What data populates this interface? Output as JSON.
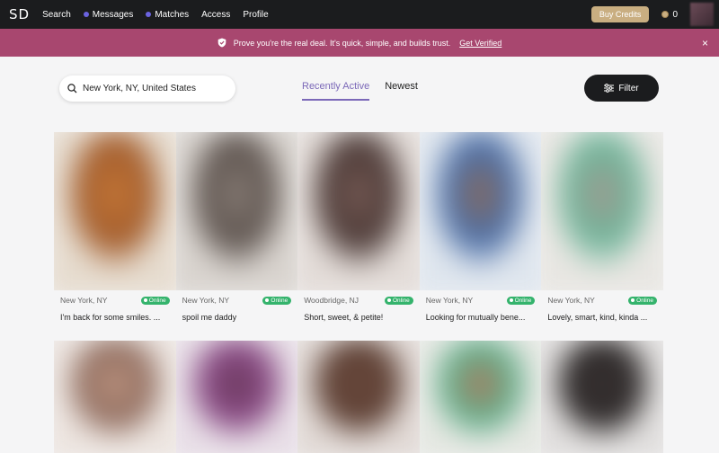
{
  "nav": {
    "logo": "SD",
    "items": [
      {
        "label": "Search",
        "dot": null
      },
      {
        "label": "Messages",
        "dot": "#6b63e0"
      },
      {
        "label": "Matches",
        "dot": "#6b63e0"
      },
      {
        "label": "Access",
        "dot": null
      },
      {
        "label": "Profile",
        "dot": null
      }
    ],
    "buy_credits": "Buy Credits",
    "credits": "0"
  },
  "banner": {
    "text": "Prove you're the real deal. It's quick, simple, and builds trust.",
    "link": "Get Verified",
    "close": "×"
  },
  "search": {
    "value": "New York, NY, United States"
  },
  "tabs": [
    {
      "label": "Recently Active",
      "active": true
    },
    {
      "label": "Newest",
      "active": false
    }
  ],
  "filter_label": "Filter",
  "profiles_row1": [
    {
      "location": "New York, NY",
      "status": "Online",
      "tagline": "I'm back for some smiles. ...",
      "colors": [
        "#c77a3a",
        "#a25b2a",
        "#e6dccf"
      ]
    },
    {
      "location": "New York, NY",
      "status": "Online",
      "tagline": "spoil me daddy",
      "colors": [
        "#8a7f78",
        "#5d534e",
        "#d9d4cf"
      ]
    },
    {
      "location": "Woodbridge, NJ",
      "status": "Online",
      "tagline": "Short, sweet, & petite!",
      "colors": [
        "#7a5e58",
        "#4a3835",
        "#e3dcd8"
      ]
    },
    {
      "location": "New York, NY",
      "status": "Online",
      "tagline": "Looking for mutually bene...",
      "colors": [
        "#8a6a5a",
        "#4b6fa8",
        "#dfe6ee"
      ]
    },
    {
      "location": "New York, NY",
      "status": "Online",
      "tagline": "Lovely, smart, kind, kinda ...",
      "colors": [
        "#a1988f",
        "#6fb59a",
        "#e8e6e2"
      ]
    }
  ],
  "profiles_row2": [
    {
      "colors": [
        "#c29a86",
        "#8e6a5c",
        "#ece4df"
      ]
    },
    {
      "colors": [
        "#6a3b5a",
        "#8a4a86",
        "#e7dde6"
      ]
    },
    {
      "colors": [
        "#6b4a3e",
        "#5c3e32",
        "#e1d9d5"
      ]
    },
    {
      "colors": [
        "#b07a5e",
        "#5fae8a",
        "#e4e7e1"
      ]
    },
    {
      "colors": [
        "#3b3434",
        "#2a2626",
        "#e0dedd"
      ]
    }
  ]
}
